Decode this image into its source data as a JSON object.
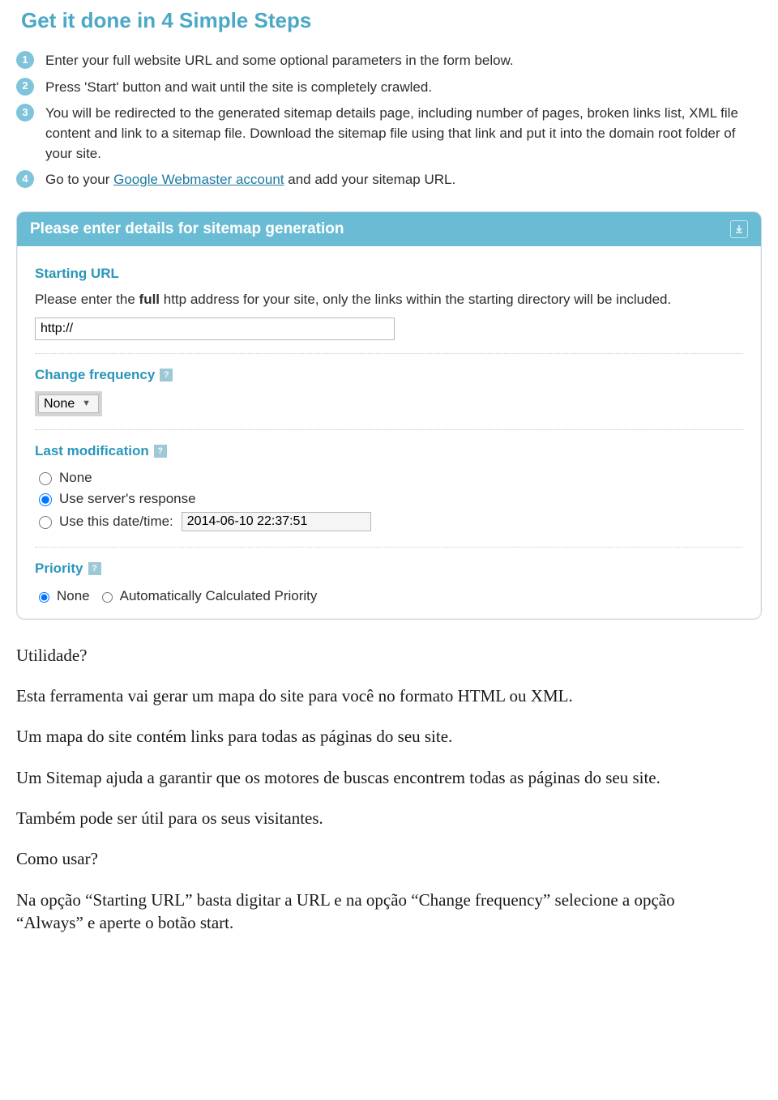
{
  "heading": "Get it done in 4 Simple Steps",
  "steps": [
    "Enter your full website URL and some optional parameters in the form below.",
    "Press 'Start' button and wait until the site is completely crawled.",
    "You will be redirected to the generated sitemap details page, including number of pages, broken links list, XML file content and link to a sitemap file. Download the sitemap file using that link and put it into the domain root folder of your site."
  ],
  "step4_prefix": "Go to your ",
  "step4_link": "Google Webmaster account",
  "step4_suffix": " and add your sitemap URL.",
  "panel_title": "Please enter details for sitemap generation",
  "starting_url": {
    "label": "Starting URL",
    "desc_prefix": "Please enter the ",
    "desc_bold": "full",
    "desc_suffix": " http address for your site, only the links within the starting directory will be included.",
    "value": "http://"
  },
  "change_freq": {
    "label": "Change frequency",
    "selected": "None"
  },
  "last_mod": {
    "label": "Last modification",
    "opt_none": "None",
    "opt_server": "Use server's response",
    "opt_date_prefix": "Use this date/time:",
    "date_value": "2014-06-10 22:37:51"
  },
  "priority": {
    "label": "Priority",
    "opt_none": "None",
    "opt_auto": "Automatically Calculated Priority"
  },
  "help_char": "?",
  "article": {
    "p1": "Utilidade?",
    "p2": "Esta ferramenta vai gerar um mapa do site para você no formato HTML ou XML.",
    "p3": "Um mapa do site contém links para todas as páginas do seu site.",
    "p4": "Um Sitemap ajuda a garantir que os motores de buscas encontrem todas as páginas do seu site.",
    "p5": "Também pode ser útil para os seus visitantes.",
    "p6": "Como usar?",
    "p7": "Na opção “Starting URL” basta digitar a URL e na opção “Change frequency” selecione a opção “Always” e aperte o botão start."
  }
}
